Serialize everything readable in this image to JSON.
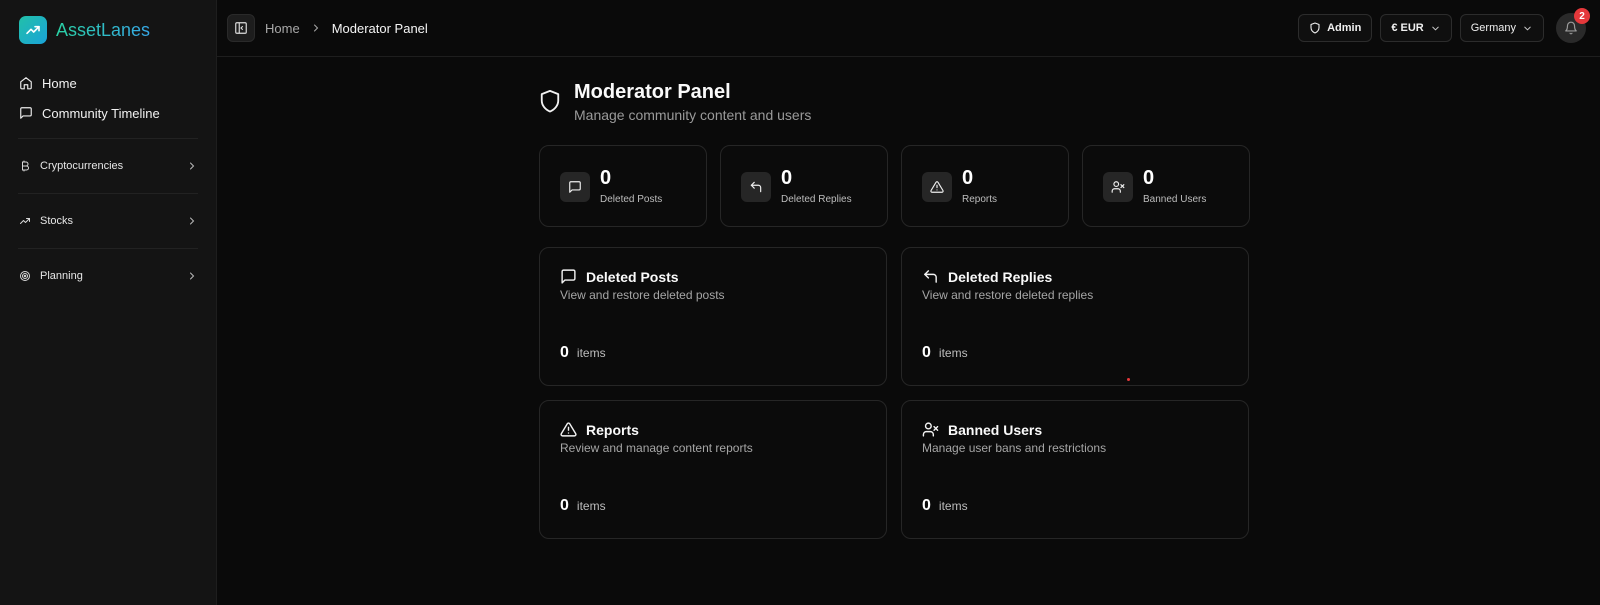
{
  "app": {
    "name": "AssetLanes",
    "colors": {
      "brand_start": "#22c0a8",
      "brand_end": "#1aa3d9",
      "badge": "#e5383b"
    }
  },
  "sidebar": {
    "top_items": [
      {
        "label": "Home",
        "icon": "home-icon"
      },
      {
        "label": "Community Timeline",
        "icon": "message-square-icon"
      }
    ],
    "groups": [
      {
        "label": "Cryptocurrencies",
        "icon": "bitcoin-icon"
      },
      {
        "label": "Stocks",
        "icon": "trending-up-icon"
      },
      {
        "label": "Planning",
        "icon": "target-icon"
      }
    ]
  },
  "header": {
    "breadcrumb": {
      "home": "Home",
      "current": "Moderator Panel"
    },
    "role": "Admin",
    "currency": "€ EUR",
    "country": "Germany",
    "notifications": "2"
  },
  "page": {
    "title": "Moderator Panel",
    "subtitle": "Manage community content and users"
  },
  "stats": [
    {
      "value": "0",
      "label": "Deleted Posts",
      "icon": "message-square-icon"
    },
    {
      "value": "0",
      "label": "Deleted Replies",
      "icon": "reply-icon"
    },
    {
      "value": "0",
      "label": "Reports",
      "icon": "alert-triangle-icon"
    },
    {
      "value": "0",
      "label": "Banned Users",
      "icon": "user-x-icon"
    }
  ],
  "cards": [
    {
      "title": "Deleted Posts",
      "description": "View and restore deleted posts",
      "count": "0",
      "unit": "items",
      "icon": "message-square-icon"
    },
    {
      "title": "Deleted Replies",
      "description": "View and restore deleted replies",
      "count": "0",
      "unit": "items",
      "icon": "reply-icon"
    },
    {
      "title": "Reports",
      "description": "Review and manage content reports",
      "count": "0",
      "unit": "items",
      "icon": "alert-triangle-icon"
    },
    {
      "title": "Banned Users",
      "description": "Manage user bans and restrictions",
      "count": "0",
      "unit": "items",
      "icon": "user-x-icon"
    }
  ]
}
